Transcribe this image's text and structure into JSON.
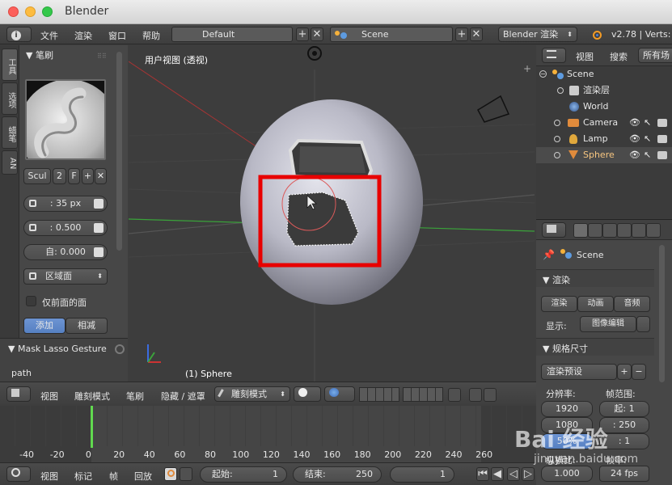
{
  "window": {
    "title": "Blender"
  },
  "info_header": {
    "menus": [
      "文件",
      "渲染",
      "窗口",
      "帮助"
    ],
    "screen_layout": "Default",
    "scene": "Scene",
    "render_engine": "Blender 渲染",
    "version": "v2.78 | Verts:"
  },
  "toolbar_tabs": [
    "工具",
    "选项",
    "蜡笔",
    "AN"
  ],
  "tool_panel": {
    "brush_section": "笔刷",
    "brush_name": "Scul",
    "brush_users": "2",
    "fake_user": "F",
    "radius": ": 35 px",
    "strength": ": 0.500",
    "autosmooth": "自:  0.000",
    "area_mode": "区域面",
    "front_faces_only": "仅前面的面",
    "add_label": "添加",
    "subtract_label": "相减",
    "gesture_section": "Mask Lasso Gesture",
    "path_label": "path"
  },
  "viewport": {
    "view_label": "用户视图 (透视)",
    "object_label": "(1) Sphere"
  },
  "outliner": {
    "header_view": "视图",
    "header_search": "搜索",
    "header_filter": "所有场",
    "rows": [
      {
        "label": "Scene"
      },
      {
        "label": "渲染层"
      },
      {
        "label": "World"
      },
      {
        "label": "Camera"
      },
      {
        "label": "Lamp"
      },
      {
        "label": "Sphere"
      }
    ]
  },
  "properties": {
    "scene_path": "Scene",
    "render_section": "渲染",
    "render_btn": "渲染",
    "anim_btn": "动画",
    "audio_btn": "音频",
    "display_label": "显示:",
    "display_value": "图像编辑",
    "dimensions_section": "规格尺寸",
    "render_presets": "渲染预设",
    "resolution_label": "分辨率:",
    "frame_range_label": "帧范围:",
    "res_x": "1920",
    "res_y": "1080",
    "res_pct": "50%",
    "frame_start": "起:  1",
    "frame_end": ":  250",
    "frame_step": ":  1",
    "aspect_label": "纵横比:",
    "frame_rate_label": "帧率:",
    "aspect_x": "1.000",
    "fps": "24 fps"
  },
  "viewport_header": {
    "view": "视图",
    "sculpt_menu": "雕刻模式",
    "brush": "笔刷",
    "hide_mask": "隐藏 / 遮罩",
    "mode": "雕刻模式"
  },
  "timeline": {
    "frame_labels": [
      "-40",
      "-20",
      "0",
      "20",
      "40",
      "60",
      "80",
      "100",
      "120",
      "140",
      "160",
      "180",
      "200",
      "220",
      "240",
      "260"
    ],
    "view": "视图",
    "marker": "标记",
    "frame": "帧",
    "playback": "回放",
    "start_label": "起始:",
    "start_value": "1",
    "end_label": "结束:",
    "end_value": "250",
    "current": "1"
  },
  "watermark": {
    "brand": "Bai 经验",
    "url": "jingyan.baidu.com"
  },
  "colors": {
    "accent_blue": "#5680c2",
    "highlight_red": "#e80000",
    "active_frame": "#61d94f"
  }
}
